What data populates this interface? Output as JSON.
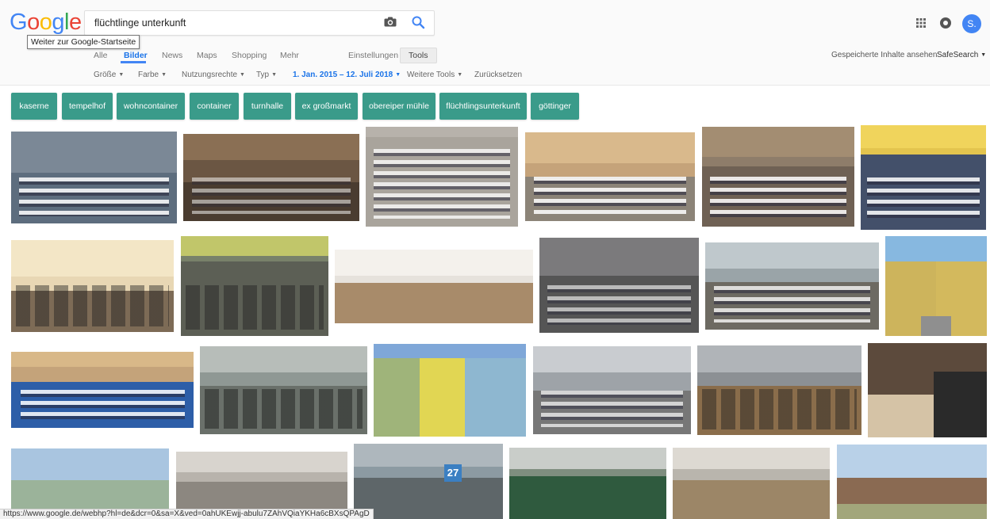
{
  "logo": {
    "letters": [
      "G",
      "o",
      "o",
      "g",
      "l",
      "e"
    ],
    "colors": [
      "#4285f4",
      "#ea4335",
      "#fbbc05",
      "#4285f4",
      "#34a853",
      "#ea4335"
    ]
  },
  "tooltip": "Weiter zur Google-Startseite",
  "search": {
    "value": "flüchtlinge unterkunft"
  },
  "user": {
    "initial": "S.",
    "avatar_color": "#4285f4"
  },
  "tabs": [
    "Alle",
    "Bilder",
    "News",
    "Maps",
    "Shopping",
    "Mehr",
    "Einstellungen"
  ],
  "tools_label": "Tools",
  "right_links": {
    "saved": "Gespeicherte Inhalte ansehen",
    "safesearch": "SafeSearch"
  },
  "filters": [
    "Größe",
    "Farbe",
    "Nutzungsrechte",
    "Typ",
    "1. Jan. 2015 – 12. Juli 2018",
    "Weitere Tools",
    "Zurücksetzen"
  ],
  "chips": [
    "kaserne",
    "tempelhof",
    "wohncontainer",
    "container",
    "turnhalle",
    "ex großmarkt",
    "obereiper mühle",
    "flüchtlingsunterkunft",
    "göttinger"
  ],
  "chip_color": "#3a9b8a",
  "status_url": "https://www.google.de/webhp?hl=de&dcr=0&sa=X&ved=0ahUKEwjj-abulu7ZAhVQiaYKHa6cBXsQPAgD"
}
